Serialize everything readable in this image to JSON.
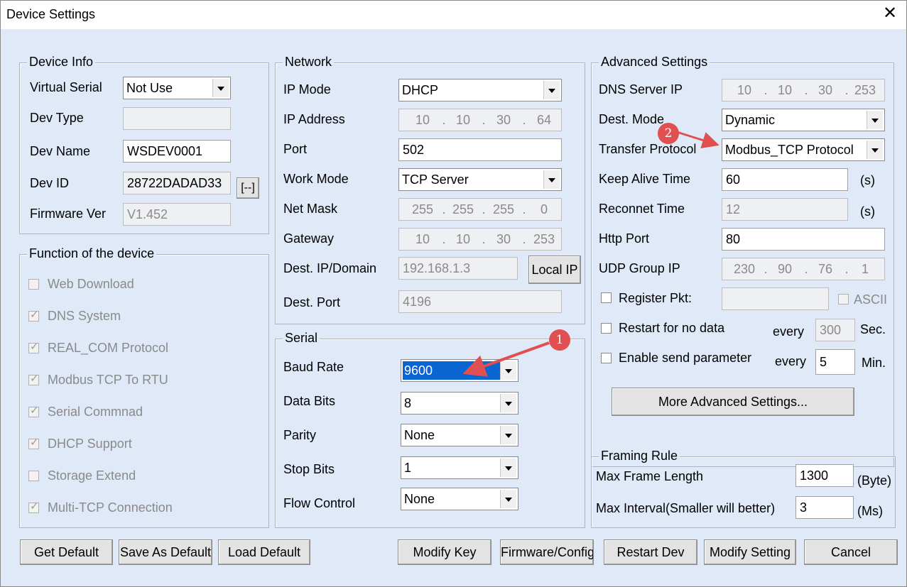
{
  "window": {
    "title": "Device Settings",
    "close": "✕"
  },
  "device_info": {
    "legend": "Device Info",
    "virtual_serial_label": "Virtual Serial",
    "virtual_serial_value": "Not Use",
    "dev_type_label": "Dev Type",
    "dev_type_value": "",
    "dev_name_label": "Dev Name",
    "dev_name_value": "WSDEV0001",
    "dev_id_label": "Dev ID",
    "dev_id_value": "28722DADAD33",
    "dev_id_button": "[--]",
    "firmware_label": "Firmware Ver",
    "firmware_value": "V1.452"
  },
  "functions": {
    "legend": "Function of the device",
    "items": [
      "Web Download",
      "DNS System",
      "REAL_COM Protocol",
      "Modbus TCP To RTU",
      "Serial Commnad",
      "DHCP Support",
      "Storage Extend",
      "Multi-TCP Connection"
    ],
    "checked": [
      false,
      true,
      true,
      true,
      true,
      true,
      false,
      true
    ]
  },
  "network": {
    "legend": "Network",
    "ip_mode_label": "IP Mode",
    "ip_mode_value": "DHCP",
    "ip_address_label": "IP Address",
    "ip_address": [
      "10",
      "10",
      "30",
      "64"
    ],
    "port_label": "Port",
    "port_value": "502",
    "work_mode_label": "Work Mode",
    "work_mode_value": "TCP Server",
    "net_mask_label": "Net Mask",
    "net_mask": [
      "255",
      "255",
      "255",
      "0"
    ],
    "gateway_label": "Gateway",
    "gateway": [
      "10",
      "10",
      "30",
      "253"
    ],
    "dest_ip_label": "Dest. IP/Domain",
    "dest_ip_value": "192.168.1.3",
    "local_ip_button": "Local IP",
    "dest_port_label": "Dest. Port",
    "dest_port_value": "4196"
  },
  "serial": {
    "legend": "Serial",
    "baud_rate_label": "Baud Rate",
    "baud_rate_value": "9600",
    "data_bits_label": "Data Bits",
    "data_bits_value": "8",
    "parity_label": "Parity",
    "parity_value": "None",
    "stop_bits_label": "Stop Bits",
    "stop_bits_value": "1",
    "flow_control_label": "Flow Control",
    "flow_control_value": "None"
  },
  "advanced": {
    "legend": "Advanced Settings",
    "dns_label": "DNS Server IP",
    "dns": [
      "10",
      "10",
      "30",
      "253"
    ],
    "dest_mode_label": "Dest. Mode",
    "dest_mode_value": "Dynamic",
    "transfer_protocol_label": "Transfer Protocol",
    "transfer_protocol_value": "Modbus_TCP Protocol",
    "keep_alive_label": "Keep Alive Time",
    "keep_alive_value": "60",
    "keep_alive_unit": "(s)",
    "reconnect_label": "Reconnet Time",
    "reconnect_value": "12",
    "reconnect_unit": "(s)",
    "http_port_label": "Http Port",
    "http_port_value": "80",
    "udp_group_label": "UDP Group IP",
    "udp_group": [
      "230",
      "90",
      "76",
      "1"
    ],
    "register_pkt_label": "Register Pkt:",
    "register_pkt_value": "",
    "ascii_label": "ASCII",
    "restart_label": "Restart for no data",
    "restart_every": "every",
    "restart_value": "300",
    "restart_unit": "Sec.",
    "enable_send_label": "Enable send parameter",
    "enable_every": "every",
    "enable_value": "5",
    "enable_unit": "Min.",
    "more_button": "More Advanced Settings..."
  },
  "framing": {
    "legend": "Framing Rule",
    "max_frame_label": "Max Frame Length",
    "max_frame_value": "1300",
    "max_frame_unit": "(Byte)",
    "max_interval_label": "Max Interval(Smaller will better)",
    "max_interval_value": "3",
    "max_interval_unit": "(Ms)"
  },
  "buttons": {
    "get_default": "Get Default",
    "save_as_default": "Save As Default",
    "load_default": "Load Default",
    "modify_key": "Modify Key",
    "firmware_config": "Firmware/Config",
    "restart_dev": "Restart Dev",
    "modify_setting": "Modify Setting",
    "cancel": "Cancel"
  },
  "annotations": {
    "badge1": "1",
    "badge2": "2",
    "color": "#e05050"
  }
}
